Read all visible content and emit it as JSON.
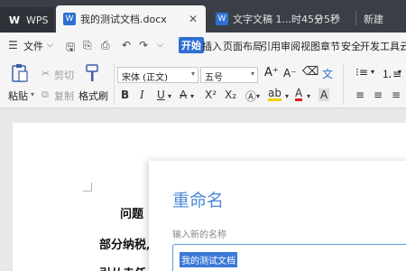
{
  "tabs": {
    "wps": "WPS",
    "active": "我的测试文档.docx",
    "second": "文字文稿 1...时45分5秒",
    "new": "新建"
  },
  "menubar": {
    "file": "文件",
    "items": [
      "开始",
      "插入",
      "页面布局",
      "引用",
      "审阅",
      "视图",
      "章节",
      "安全",
      "开发工具",
      "云"
    ]
  },
  "ribbon": {
    "paste": "粘贴",
    "cut": "剪切",
    "copy": "复制",
    "format_painter": "格式刷",
    "font_name": "宋体 (正文)",
    "font_size": "五号"
  },
  "document": {
    "line1": "问题",
    "line2": "部分纳税,",
    "line3": "引从走任"
  },
  "dialog": {
    "title": "重命名",
    "label": "输入新的名称",
    "value": "我的测试文档"
  },
  "colors": {
    "accent": "#2f6fd3",
    "dialog_title": "#4a8ad8",
    "selection": "#3b78d8"
  }
}
